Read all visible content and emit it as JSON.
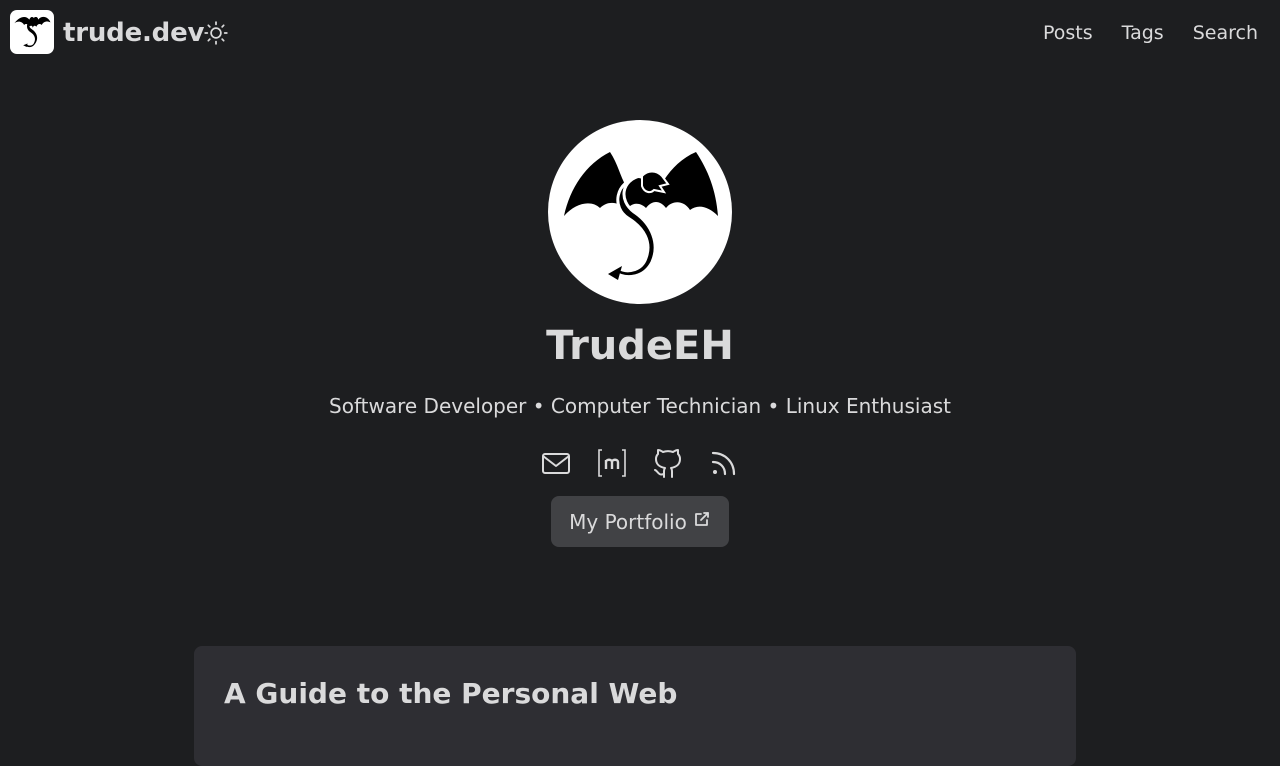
{
  "header": {
    "site_title": "trude.dev",
    "menu": [
      {
        "label": "Posts"
      },
      {
        "label": "Tags"
      },
      {
        "label": "Search"
      }
    ],
    "theme_icon": "sun-icon",
    "logo_icon": "dragon-logo-icon"
  },
  "hero": {
    "avatar_icon": "dragon-avatar-icon",
    "name": "TrudeEH",
    "subtitle": "Software Developer • Computer Technician • Linux Enthusiast",
    "social_links": [
      {
        "icon": "mail-icon"
      },
      {
        "icon": "matrix-icon"
      },
      {
        "icon": "github-icon"
      },
      {
        "icon": "rss-icon"
      }
    ],
    "portfolio_button": {
      "label": "My Portfolio",
      "icon": "external-link-icon"
    }
  },
  "posts": [
    {
      "title": "A Guide to the Personal Web"
    }
  ],
  "colors": {
    "background": "#1d1e20",
    "text": "#dadadb",
    "button_bg": "#414245",
    "card_bg": "#2e2e33"
  }
}
